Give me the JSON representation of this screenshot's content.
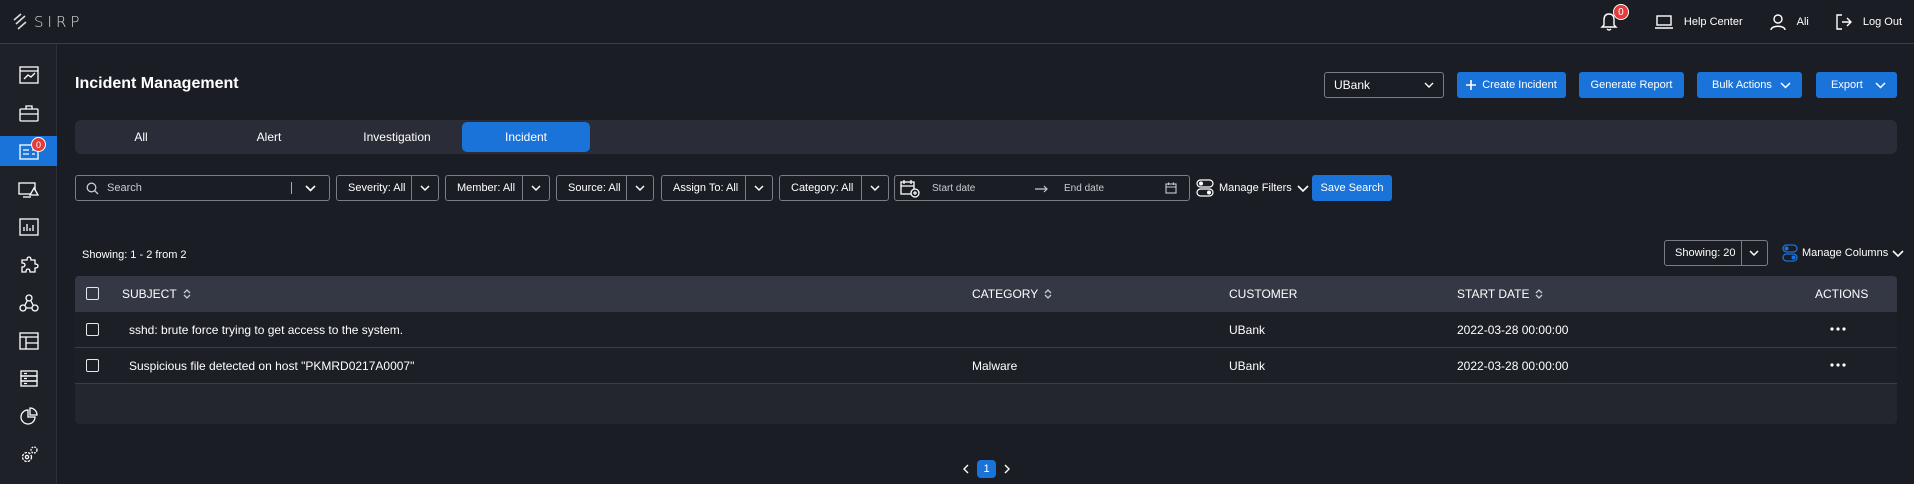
{
  "app": {
    "logo_text": "SIRP"
  },
  "topbar": {
    "notification_count": "0",
    "help_center": "Help Center",
    "user_name": "Ali",
    "logout": "Log Out"
  },
  "sidebar": {
    "items": [
      {
        "icon": "dashboard-icon"
      },
      {
        "icon": "briefcase-icon"
      },
      {
        "icon": "incident-management-icon",
        "badge": "0",
        "active": true
      },
      {
        "icon": "threat-intel-icon"
      },
      {
        "icon": "reports-chart-icon"
      },
      {
        "icon": "puzzle-integrations-icon"
      },
      {
        "icon": "network-icon"
      },
      {
        "icon": "board-icon"
      },
      {
        "icon": "database-icon"
      },
      {
        "icon": "pie-chart-icon"
      },
      {
        "icon": "settings-gears-icon"
      }
    ]
  },
  "header": {
    "title": "Incident Management",
    "customer_selected": "UBank",
    "create_incident": "Create Incident",
    "generate_report": "Generate Report",
    "bulk_actions": "Bulk Actions",
    "export": "Export"
  },
  "tabs": [
    {
      "label": "All",
      "active": false
    },
    {
      "label": "Alert",
      "active": false
    },
    {
      "label": "Investigation",
      "active": false
    },
    {
      "label": "Incident",
      "active": true
    }
  ],
  "filters": {
    "search_placeholder": "Search",
    "severity": "Severity: All",
    "member": "Member: All",
    "source": "Source: All",
    "assign_to": "Assign To: All",
    "category": "Category: All",
    "start_date_placeholder": "Start date",
    "end_date_placeholder": "End date",
    "manage_filters": "Manage Filters",
    "save_search": "Save Search"
  },
  "results": {
    "showing_text": "Showing: 1 - 2 from 2",
    "page_size": "Showing: 20",
    "manage_columns": "Manage Columns"
  },
  "table": {
    "columns": {
      "subject": "SUBJECT",
      "category": "CATEGORY",
      "customer": "CUSTOMER",
      "start_date": "START DATE",
      "actions": "ACTIONS"
    },
    "rows": [
      {
        "subject": "sshd: brute force trying to get access to the system.",
        "category": "",
        "customer": "UBank",
        "start_date": "2022-03-28 00:00:00"
      },
      {
        "subject": "Suspicious file detected on host \"PKMRD0217A0007\"",
        "category": "Malware",
        "customer": "UBank",
        "start_date": "2022-03-28 00:00:00"
      }
    ]
  },
  "pagination": {
    "current_page": "1"
  },
  "colors": {
    "accent": "#1a73d9",
    "badge": "#e23c3c",
    "background": "#1b1d24"
  }
}
